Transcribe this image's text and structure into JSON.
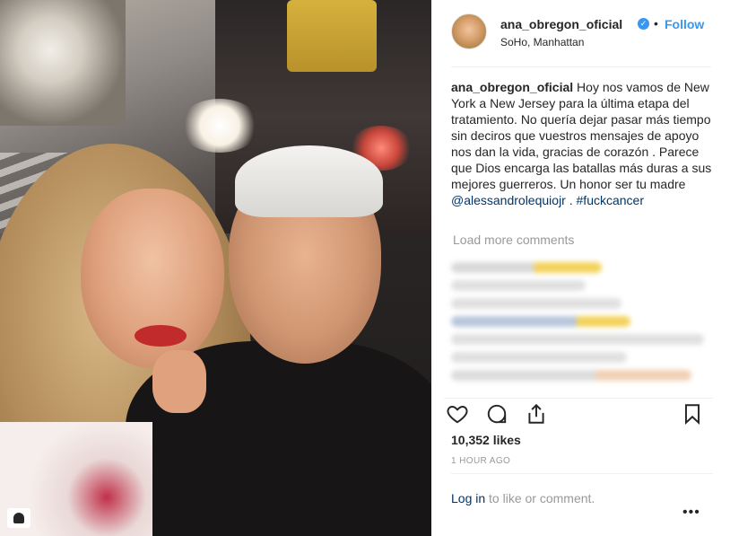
{
  "post": {
    "username": "ana_obregon_oficial",
    "follow_label": "Follow",
    "dot": "•",
    "location": "SoHo, Manhattan",
    "caption_text": "Hoy nos vamos de New York a New Jersey para la última etapa del tratamiento. No quería dejar pasar más tiempo sin deciros que vuestros mensajes de apoyo nos dan la vida, gracias de corazón . Parece que Dios encarga las batallas más duras a sus mejores guerreros. Un honor ser tu madre ",
    "mention": "@alessandrolequiojr",
    "caption_sep": " . ",
    "hashtag": "#fuckcancer",
    "load_more": "Load more comments",
    "likes": "10,352 likes",
    "time": "1 HOUR AGO",
    "login_link": "Log in",
    "login_rest": " to like or comment.",
    "more_label": "•••"
  },
  "colors": {
    "accent": "#3897f0",
    "link": "#003569",
    "muted": "#999999"
  },
  "icons": {
    "like": "heart-icon",
    "comment": "comment-icon",
    "share": "share-icon",
    "save": "bookmark-icon",
    "gallery": "user-tag-icon",
    "verified": "verified-icon"
  }
}
